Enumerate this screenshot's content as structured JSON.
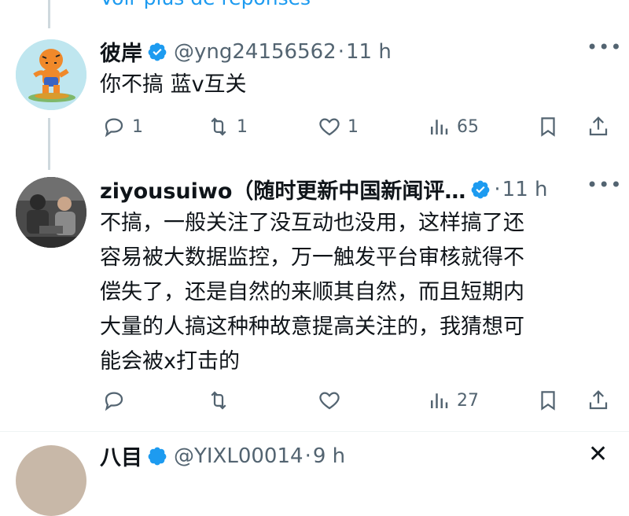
{
  "more_replies_label": "Voir plus de réponses",
  "tweets": [
    {
      "author_name": "彼岸",
      "handle": "@yng24156562",
      "dot": "·",
      "time": "11 h",
      "text": "你不搞 蓝v互关",
      "actions": {
        "replies": "1",
        "retweets": "1",
        "likes": "1",
        "views": "65"
      }
    },
    {
      "author_name": "ziyousuiwo（随时更新中国新闻评…",
      "dot": "·",
      "time": "11 h",
      "text_lines": [
        "不搞，一般关注了没互动也没用，这样搞了还",
        "容易被大数据监控，万一触发平台审核就得不",
        "偿失了，还是自然的来顺其自然，而且短期内",
        "大量的人搞这种种故意提高关注的，我猜想可",
        "能会被x打击的"
      ],
      "actions": {
        "replies": "",
        "retweets": "",
        "likes": "",
        "views": "27"
      }
    },
    {
      "author_name": "八目",
      "handle": "@YIXL00014",
      "dot": "·",
      "time": "9 h"
    }
  ],
  "colors": {
    "accent": "#1d9bf0",
    "text": "#0f1419",
    "muted": "#536471",
    "line": "#cfd9de"
  }
}
